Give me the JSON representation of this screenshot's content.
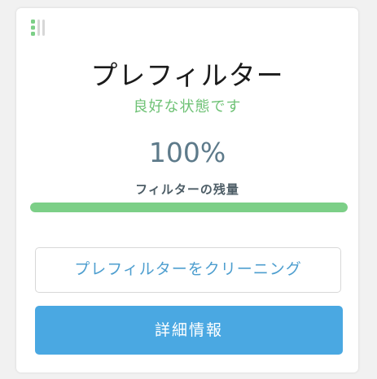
{
  "card": {
    "title": "プレフィルター",
    "status": "良好な状態です",
    "percent": "100%",
    "remaining_label": "フィルターの残量",
    "remaining_fraction": 1.0,
    "clean_button": "プレフィルターをクリーニング",
    "detail_button": "詳細情報"
  },
  "icons": {
    "drag_handle": "drag-handle-icon"
  },
  "colors": {
    "status_green": "#6fc276",
    "progress_fill": "#7ccf87",
    "accent_blue": "#4aa8e2",
    "percent_text": "#5d7a8a"
  }
}
